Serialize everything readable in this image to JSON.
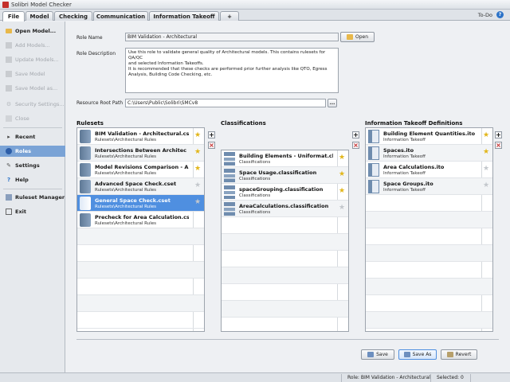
{
  "window": {
    "title": "Solibri Model Checker"
  },
  "tabs": [
    {
      "label": "File",
      "active": true
    },
    {
      "label": "Model",
      "active": false
    },
    {
      "label": "Checking",
      "active": false
    },
    {
      "label": "Communication",
      "active": false
    },
    {
      "label": "Information Takeoff",
      "active": false
    },
    {
      "label": "+",
      "active": false
    }
  ],
  "topbar": {
    "todo": "To-Do",
    "help_glyph": "?"
  },
  "sidebar": {
    "items": [
      {
        "label": "Open Model...",
        "icon": "folder-icon",
        "enabled": true
      },
      {
        "label": "Add Models...",
        "icon": "add-model-icon",
        "enabled": false
      },
      {
        "label": "Update Models...",
        "icon": "update-model-icon",
        "enabled": false
      },
      {
        "label": "Save Model",
        "icon": "save-icon",
        "enabled": false
      },
      {
        "label": "Save Model as...",
        "icon": "save-as-icon",
        "enabled": false
      },
      {
        "label": "Security Settings...",
        "icon": "gear-icon",
        "enabled": false
      },
      {
        "label": "Close",
        "icon": "close-icon",
        "enabled": false
      },
      {
        "label": "Recent",
        "icon": "recent-icon",
        "enabled": true
      },
      {
        "label": "Roles",
        "icon": "roles-icon",
        "enabled": true,
        "selected": true
      },
      {
        "label": "Settings",
        "icon": "wrench-icon",
        "enabled": true
      },
      {
        "label": "Help",
        "icon": "help-icon",
        "enabled": true
      },
      {
        "label": "Ruleset Manager",
        "icon": "ruleset-manager-icon",
        "enabled": true
      },
      {
        "label": "Exit",
        "icon": "exit-icon",
        "enabled": true
      }
    ]
  },
  "form": {
    "role_name_label": "Role Name",
    "role_name_value": "BIM Validation - Architectural",
    "open_button": "Open",
    "role_desc_label": "Role Description",
    "role_desc_lines": [
      "Use this role to validate general quality of Architectural models. This contains rulesets for QA/QC",
      "and selected Information Takeoffs.",
      "It is recommended that these checks are performed prior further analysis like QTO, Egress",
      "Analysis, Building Code Checking, etc."
    ],
    "root_path_label": "Resource Root Path",
    "root_path_value": "C:\\Users\\Public\\Solibri\\SMCv8",
    "browse_button": "..."
  },
  "rulesets": {
    "title": "Rulesets",
    "items": [
      {
        "name": "BIM Validation - Architectural.cs",
        "sub": "Rulesets\\Architectural Rules",
        "starred": true
      },
      {
        "name": "Intersections Between Architec",
        "sub": "Rulesets\\Architectural Rules",
        "starred": true
      },
      {
        "name": "Model Revisions Comparison - A",
        "sub": "Rulesets\\Architectural Rules",
        "starred": true
      },
      {
        "name": "Advanced Space Check.cset",
        "sub": "Rulesets\\Architectural Rules",
        "starred": false
      },
      {
        "name": "General Space Check.cset",
        "sub": "Rulesets\\Architectural Rules",
        "starred": false,
        "selected": true
      },
      {
        "name": "Precheck for Area Calculation.cs",
        "sub": "Rulesets\\Architectural Rules",
        "starred": false
      }
    ]
  },
  "classifications": {
    "title": "Classifications",
    "items": [
      {
        "name": "Building Elements - Uniformat.cla",
        "sub": "Classifications",
        "starred": true
      },
      {
        "name": "Space Usage.classification",
        "sub": "Classifications",
        "starred": true
      },
      {
        "name": "spaceGrouping.classification",
        "sub": "Classifications",
        "starred": true
      },
      {
        "name": "AreaCalculations.classification",
        "sub": "Classifications",
        "starred": false
      }
    ]
  },
  "takeoffs": {
    "title": "Information Takeoff Definitions",
    "items": [
      {
        "name": "Building Element Quantities.ito",
        "sub": "Information Takeoff",
        "starred": true
      },
      {
        "name": "Spaces.ito",
        "sub": "Information Takeoff",
        "starred": true
      },
      {
        "name": "Area Calculations.ito",
        "sub": "Information Takeoff",
        "starred": false
      },
      {
        "name": "Space Groups.ito",
        "sub": "Information Takeoff",
        "starred": false
      }
    ]
  },
  "buttons": {
    "save": "Save",
    "save_as": "Save As",
    "revert": "Revert"
  },
  "status": {
    "role": "Role: BIM Validation - Architectural",
    "selected": "Selected: 0"
  },
  "colors": {
    "accent": "#4f8fe0",
    "star": "#e2b61a",
    "delete": "#c52424"
  }
}
